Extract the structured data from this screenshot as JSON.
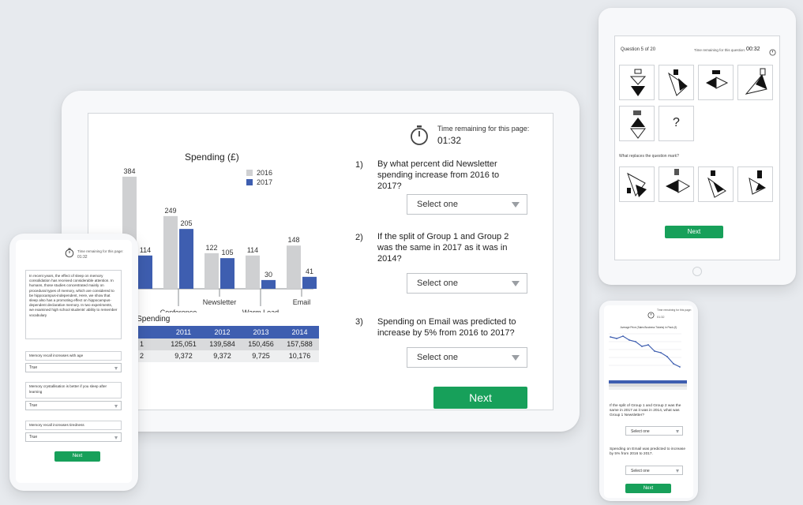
{
  "tablet": {
    "timer_label": "Time remaining for this page:",
    "timer_value": "01:32",
    "chart": {
      "title": "Spending (£)",
      "legend": [
        "2016",
        "2017"
      ],
      "colors": {
        "2016": "#cfd0d2",
        "2017": "#3e5eb0"
      },
      "categories_visible": [
        "Conference",
        "Newsletter",
        "Warm Lead",
        "Email"
      ]
    },
    "table": {
      "title_fragment": "r Spending",
      "headers": [
        "2011",
        "2012",
        "2013",
        "2014"
      ],
      "rows": [
        {
          "label": "1",
          "values": [
            "125,051",
            "139,584",
            "150,456",
            "157,588"
          ]
        },
        {
          "label": "2",
          "values": [
            "9,372",
            "9,372",
            "9,725",
            "10,176"
          ]
        }
      ]
    },
    "questions": [
      {
        "number": "1)",
        "text": "By what percent did Newsletter spending increase from 2016 to 2017?",
        "select": "Select one"
      },
      {
        "number": "2)",
        "text": "If the split of Group 1 and Group 2 was the same in 2017 as it was in 2014?",
        "select": "Select one"
      },
      {
        "number": "3)",
        "text": "Spending on Email was predicted to increase by 5% from 2016 to 2017?",
        "select": "Select one"
      }
    ],
    "next_label": "Next"
  },
  "chart_data": {
    "type": "bar",
    "title": "Spending (£)",
    "categories": [
      "",
      "Conference",
      "Newsletter",
      "Warm Lead",
      "Email"
    ],
    "series": [
      {
        "name": "2016",
        "values": [
          384,
          249,
          122,
          114,
          148
        ]
      },
      {
        "name": "2017",
        "values": [
          114,
          205,
          105,
          30,
          41
        ]
      }
    ],
    "ylim": [
      0,
      400
    ],
    "legend": "top-right",
    "grid": false
  },
  "ipad": {
    "question_counter": "Question 5 of 20",
    "timer_label": "Time remaining for this question:",
    "timer_value": "00:32",
    "question_mark": "?",
    "prompt": "What replaces the question mark?",
    "next_label": "Next"
  },
  "phone_left": {
    "timer_label": "Time remaining for this page:",
    "timer_value": "01:32",
    "passage": "In recent years, the effect of sleep on memory consolidation has received considerable attention. In humans, those studies concentrated mainly on procedural types of memory, which are considered to be hippocampus-independent, Here, we show that sleep also has a promoting effect on hippocampus-dependent declarative memory. In two experiments, we examined high school students' ability to remember vocabulary",
    "statements": [
      {
        "text": "Memory recall increases with age",
        "answer": "True"
      },
      {
        "text": "Memory crystallisation is better if you sleep after learning",
        "answer": "True"
      },
      {
        "text": "Memory recall increases tiredness",
        "answer": "True"
      }
    ],
    "next_label": "Next"
  },
  "phone_right": {
    "timer_label": "Time remaining for this page:",
    "timer_value": "01:32",
    "chart_title": "Average Price (Sales Business Tickets) in Pack (£)",
    "questions": [
      {
        "text": "If the split of Group 1 and Group 2 was the same in 2017 as it was in 2014, what was Group 1 Newsletter?",
        "select": "Select one"
      },
      {
        "text": "Spending on Email was predicted to increase by 5% from 2016 to 2017.",
        "select": "Select one"
      }
    ],
    "next_label": "Next"
  }
}
